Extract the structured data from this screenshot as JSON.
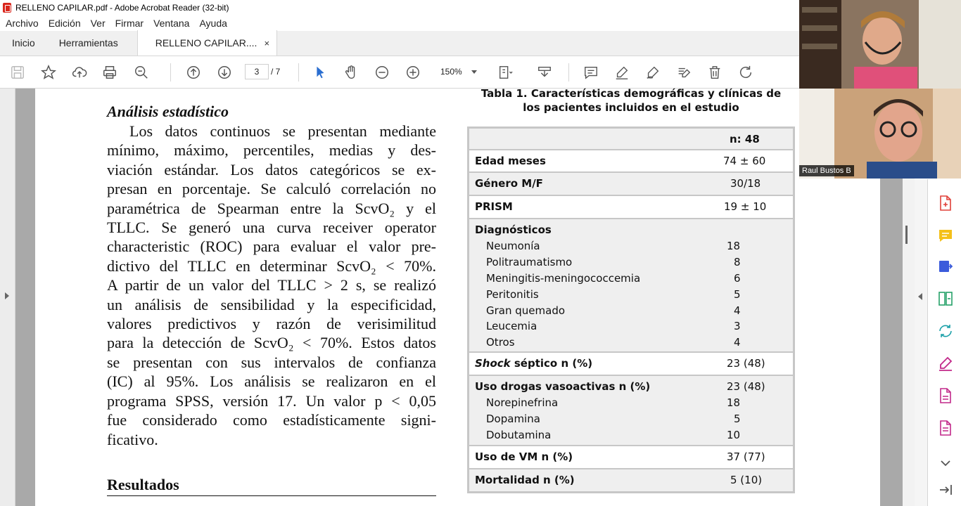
{
  "window": {
    "title": "RELLENO CAPILAR.pdf - Adobe Acrobat Reader (32-bit)"
  },
  "menu": [
    "Archivo",
    "Edición",
    "Ver",
    "Firmar",
    "Ventana",
    "Ayuda"
  ],
  "tabs": {
    "home": "Inicio",
    "tools": "Herramientas",
    "doc": "RELLENO CAPILAR....",
    "close": "×"
  },
  "toolbar": {
    "page_current": "3",
    "page_total": "/ 7",
    "zoom": "150%"
  },
  "document": {
    "heading": "Análisis estadístico",
    "para_lines": [
      "Los datos continuos se presentan mediante",
      "mínimo, máximo, percentiles, medias y des-",
      "viación estándar. Los datos categóricos se ex-",
      "presan en porcentaje. Se calculó correlación no",
      "paramétrica de Spearman entre la ScvO₂ y el",
      "TLLC. Se generó una curva receiver operator",
      "characteristic (ROC) para evaluar el valor pre-",
      "dictivo del TLLC en determinar ScvO₂ < 70%.",
      "A partir de un valor del TLLC > 2 s, se realizó",
      "un análisis de sensibilidad y la especificidad,",
      "valores predictivos y razón de verisimilitud",
      "para la detección de ScvO₂ < 70%. Estos datos",
      "se presentan con sus intervalos de confianza",
      "(IC) al 95%. Los análisis se realizaron en el",
      "programa SPSS, versión 17. Un valor p < 0,05",
      "fue considerado como estadísticamente signi-",
      "ficativo."
    ],
    "results_heading": "Resultados",
    "table": {
      "title_line1": "Tabla 1. Características demográficas y clínicas de",
      "title_line2": "los pacientes incluidos en el estudio",
      "header_value": "n: 48",
      "edad_label": "Edad meses",
      "edad_value": "74 ± 60",
      "genero_label": "Género M/F",
      "genero_value": "30/18",
      "prism_label": "PRISM",
      "prism_value": "19 ± 10",
      "diag_label": "Diagnósticos",
      "diagnoses": [
        {
          "name": "Neumonía",
          "value": "18"
        },
        {
          "name": "Politraumatismo",
          "value": "8"
        },
        {
          "name": "Meningitis-meningococcemia",
          "value": "6"
        },
        {
          "name": "Peritonitis",
          "value": "5"
        },
        {
          "name": "Gran quemado",
          "value": "4"
        },
        {
          "name": "Leucemia",
          "value": "3"
        },
        {
          "name": "Otros",
          "value": "4"
        }
      ],
      "shock_label_italic": "Shock",
      "shock_label_rest": " séptico n (%)",
      "shock_value": "23 (48)",
      "drogas_label": "Uso drogas vasoactivas n (%)",
      "drogas_value": "23 (48)",
      "drogas": [
        {
          "name": "Norepinefrina",
          "value": "18"
        },
        {
          "name": "Dopamina",
          "value": "5"
        },
        {
          "name": "Dobutamina",
          "value": "10"
        }
      ],
      "vm_label": "Uso de VM n (%)",
      "vm_value": "37 (77)",
      "mort_label": "Mortalidad n (%)",
      "mort_value": "5 (10)"
    }
  },
  "webcam": {
    "participant2": "Raul Bustos B"
  }
}
